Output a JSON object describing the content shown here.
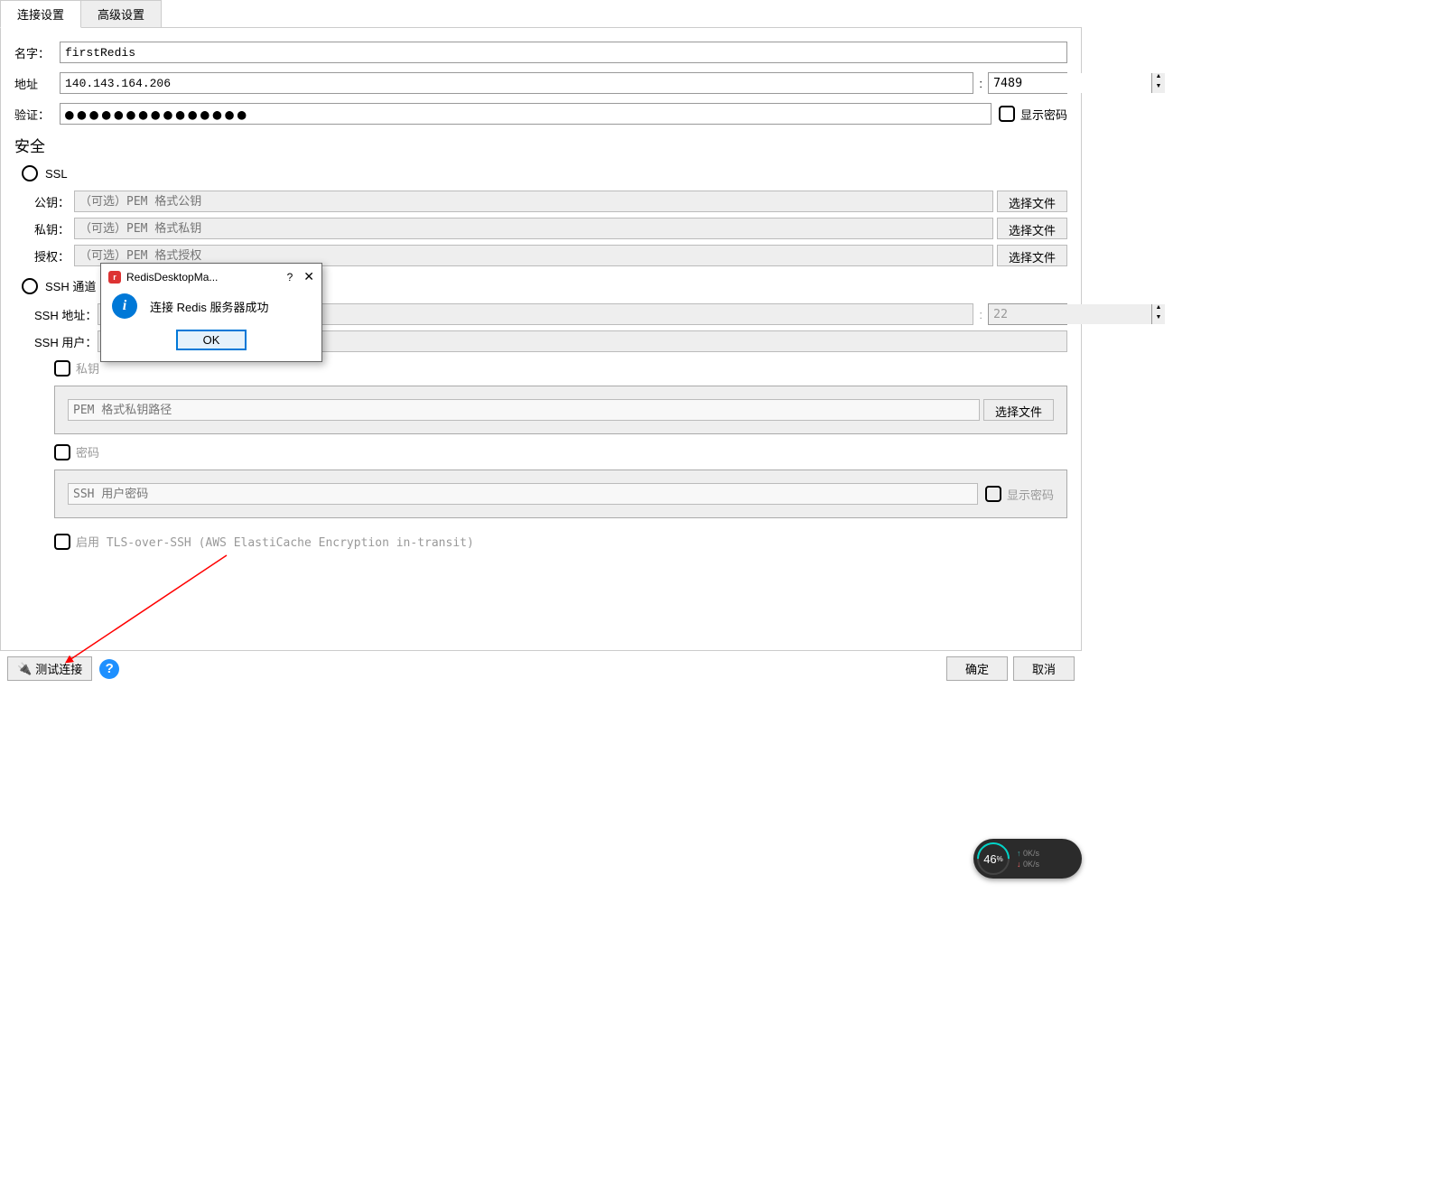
{
  "tabs": {
    "connection": "连接设置",
    "advanced": "高级设置"
  },
  "form": {
    "name_label": "名字：",
    "name_value": "firstRedis",
    "addr_label": "地址",
    "addr_value": "140.143.164.206",
    "port_value": "7489",
    "auth_label": "验证：",
    "auth_value": "●●●●●●●●●●●●●●●",
    "show_password": "显示密码",
    "colon": ":"
  },
  "security": {
    "title": "安全",
    "ssl_label": "SSL",
    "pubkey_label": "公钥：",
    "pubkey_placeholder": "（可选）PEM 格式公钥",
    "privkey_label": "私钥：",
    "privkey_placeholder": "（可选）PEM 格式私钥",
    "auth_label": "授权：",
    "auth_placeholder": "（可选）PEM 格式授权",
    "choose_file": "选择文件",
    "ssh_label": "SSH 通道",
    "ssh_addr_label": "SSH 地址：",
    "ssh_port": "22",
    "ssh_user_label": "SSH 用户：",
    "ssh_privkey": "私钥",
    "ssh_privkey_placeholder": "PEM 格式私钥路径",
    "ssh_password": "密码",
    "ssh_password_placeholder": "SSH 用户密码",
    "ssh_show_password": "显示密码",
    "tls_label": "启用 TLS-over-SSH (AWS ElastiCache Encryption in-transit)"
  },
  "dialog": {
    "title": "RedisDesktopMa...",
    "help": "?",
    "close": "✕",
    "message": "连接 Redis 服务器成功",
    "ok": "OK"
  },
  "footer": {
    "test": "测试连接",
    "ok": "确定",
    "cancel": "取消",
    "help": "?"
  },
  "widget": {
    "percent": "46",
    "percent_suffix": "%",
    "up": "0K/s",
    "down": "0K/s"
  }
}
